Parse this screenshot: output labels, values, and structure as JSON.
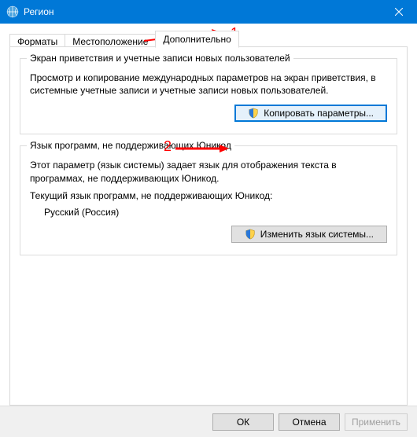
{
  "titlebar": {
    "title": "Регион"
  },
  "tabs": {
    "formats": "Форматы",
    "location": "Местоположение",
    "advanced": "Дополнительно"
  },
  "group1": {
    "title": "Экран приветствия и учетные записи новых пользователей",
    "desc": "Просмотр и копирование международных параметров на экран приветствия, в системные учетные записи и учетные записи новых пользователей.",
    "btn": "Копировать параметры..."
  },
  "group2": {
    "title": "Язык программ, не поддерживающих Юникод",
    "desc": "Этот параметр (язык системы) задает язык для отображения текста в программах, не поддерживающих Юникод.",
    "current_label": "Текущий язык программ, не поддерживающих Юникод:",
    "current_value": "Русский (Россия)",
    "btn": "Изменить язык системы..."
  },
  "footer": {
    "ok": "ОК",
    "cancel": "Отмена",
    "apply": "Применить"
  },
  "annotations": {
    "n1": "1",
    "n2": "2"
  }
}
